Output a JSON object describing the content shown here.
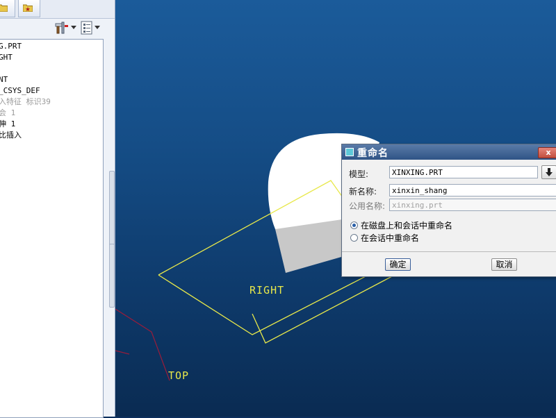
{
  "left_panel": {
    "tabs": [
      {
        "icon": "folder-icon"
      },
      {
        "icon": "favorites-icon"
      }
    ],
    "toolbar": {
      "settings_icon": "tools-icon",
      "show_icon": "list-view-icon"
    },
    "tree_items": [
      {
        "text": "G.PRT",
        "dim": false
      },
      {
        "text": "GHT",
        "dim": false
      },
      {
        "text": "",
        "dim": false
      },
      {
        "text": "NT",
        "dim": false
      },
      {
        "text": "_CSYS_DEF",
        "dim": false
      },
      {
        "text": "入特征 标识39",
        "dim": true
      },
      {
        "text": "会 1",
        "dim": true
      },
      {
        "text": "伸 1",
        "dim": false
      },
      {
        "text": "比插入",
        "dim": false
      }
    ]
  },
  "viewport": {
    "plane_labels": {
      "right": "RIGHT",
      "top": "TOP"
    },
    "colors": {
      "datum_plane": "#e8e84a",
      "top_plane": "#9b1c3a",
      "model_light": "#ffffff",
      "model_shade": "#c8c8c8"
    }
  },
  "dialog": {
    "title": "重命名",
    "close_label": "x",
    "model_label": "模型:",
    "model_value": "XINXING.PRT",
    "new_name_label": "新名称:",
    "new_name_value": "xinxin_shang",
    "common_name_label": "公用名称:",
    "common_name_value": "xinxing.prt",
    "options": [
      {
        "label": "在磁盘上和会话中重命名",
        "selected": true
      },
      {
        "label": "在会话中重命名",
        "selected": false
      }
    ],
    "ok_label": "确定",
    "cancel_label": "取消"
  }
}
